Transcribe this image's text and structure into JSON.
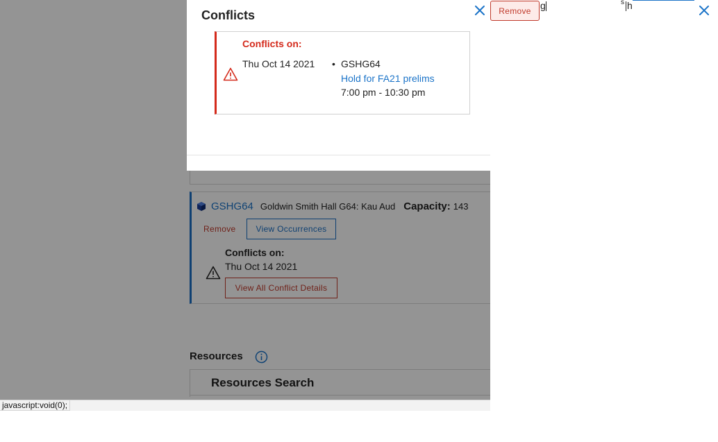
{
  "modal": {
    "title": "Conflicts",
    "conflict_heading": "Conflicts on:",
    "date": "Thu Oct 14 2021",
    "bullet": "•",
    "location_code": "GSHG64",
    "event_link": "Hold for FA21 prelims",
    "time_range": "7:00 pm - 10:30 pm"
  },
  "location_card": {
    "code": "GSHG64",
    "name": "Goldwin Smith Hall G64: Kau Aud",
    "capacity_label": "Capacity:",
    "capacity_value": "143",
    "remove_label": "Remove",
    "view_occurrences_label": "View Occurrences",
    "conflicts_label": "Conflicts on:",
    "conflict_date": "Thu Oct 14 2021",
    "view_all_label": "View All Conflict Details"
  },
  "resources": {
    "title": "Resources",
    "search_title": "Resources Search"
  },
  "status_bar": {
    "text": "javascript:void(0);"
  },
  "right_fragments": {
    "remove_label": "Remove",
    "text_g": "g",
    "text_s": "s",
    "text_h": "h"
  },
  "icons": {
    "close": "close-icon",
    "warning": "warning-icon",
    "info": "info-icon",
    "cube": "cube-icon"
  },
  "colors": {
    "accent_blue": "#1a73c8",
    "danger_red": "#d42a1b",
    "overlay": "rgba(0,0,0,0.42)"
  }
}
